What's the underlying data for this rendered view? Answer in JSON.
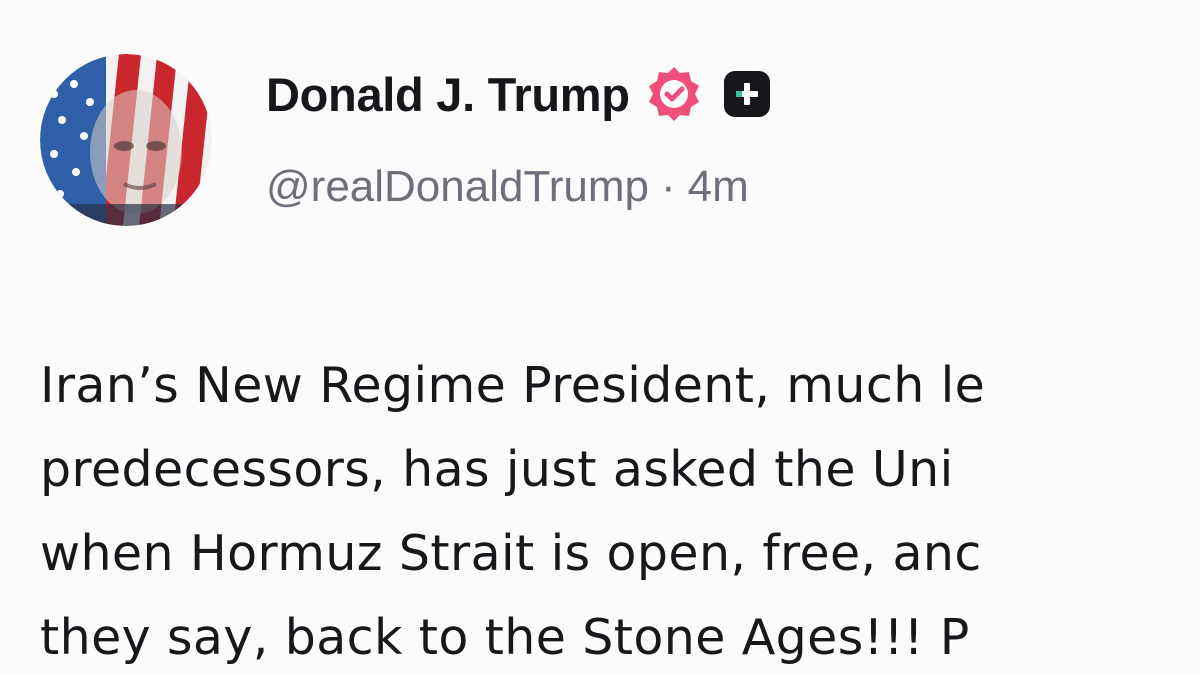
{
  "post": {
    "author": {
      "display_name": "Donald J. Trump",
      "handle": "@realDonaldTrump",
      "time_sep": "·",
      "timestamp": "4m",
      "avatar_icon": "american-flag-portrait-avatar",
      "verified_icon": "verified-badge-icon",
      "verified_color": "#f04e7a",
      "plus_icon": "truth-plus-icon"
    },
    "text_lines": [
      "Iran’s New Regime President, much le",
      "predecessors, has just asked the Uni",
      "when Hormuz Strait is open, free, anc",
      "they say, back to the Stone Ages!!! P"
    ]
  },
  "colors": {
    "background": "#fbfbfb",
    "text": "#17171c",
    "muted": "#6e6f7a",
    "badge_pink": "#f04e7a",
    "plus_dark": "#16161b",
    "plus_accent": "#34c5a0"
  }
}
